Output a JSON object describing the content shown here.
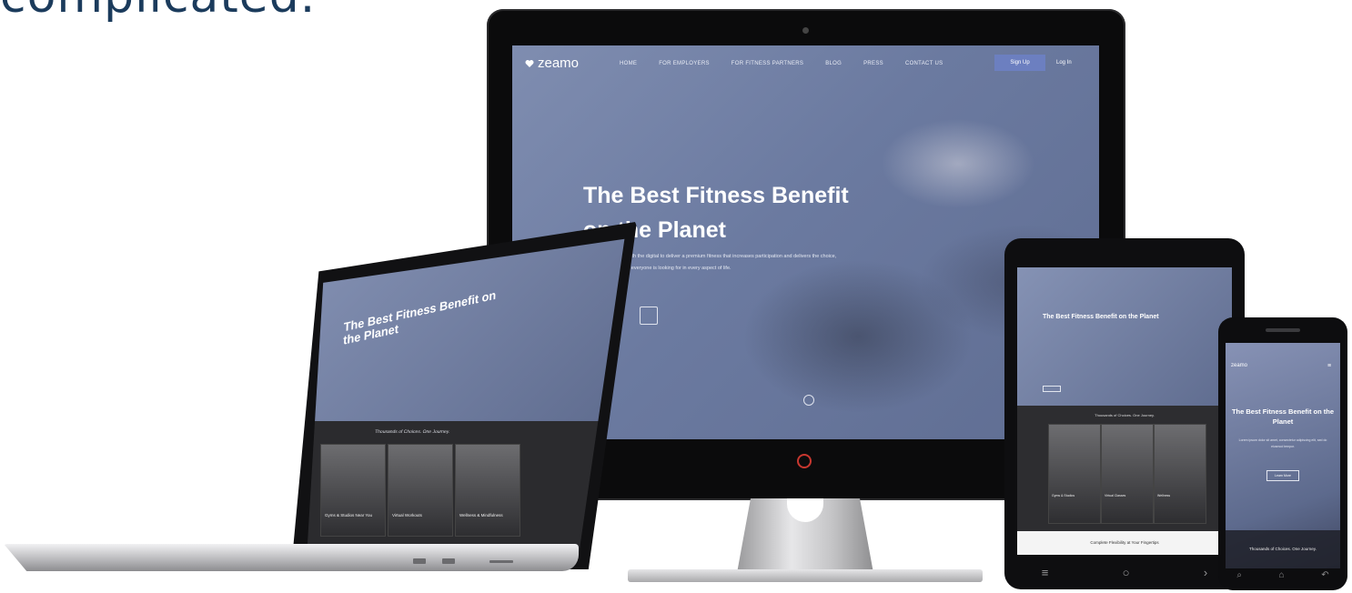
{
  "headline": "complicated.",
  "desktop": {
    "logo": "zeamo",
    "nav_links": [
      "Home",
      "For Employers",
      "For Fitness Partners",
      "Blog",
      "Press",
      "Contact Us"
    ],
    "signup_label": "Sign Up",
    "login_label": "Log In",
    "hero_title_line1": "The Best Fitness Benefit",
    "hero_title_line2": "on the Planet",
    "hero_copy": "blends the physical with the digital to deliver a premium fitness that increases participation and delivers the choice, flexibility, and access everyone is looking for in every aspect of life."
  },
  "laptop": {
    "hero_title": "The Best Fitness Benefit on the Planet",
    "section_title": "Thousands of Choices. One Journey.",
    "cards": [
      "Gyms & Studios Near You",
      "Virtual Workouts",
      "Wellness & Mindfulness"
    ]
  },
  "tablet": {
    "hero_title": "The Best Fitness Benefit on the Planet",
    "section_title": "Thousands of Choices. One Journey.",
    "cards": [
      "Gyms & Studios",
      "Virtual Classes",
      "Wellness"
    ],
    "footer": "Complete Flexibility at Your Fingertips"
  },
  "phone": {
    "logo": "zeamo",
    "hero_title": "The Best Fitness Benefit on the Planet",
    "hero_copy": "Lorem ipsum dolor sit amet, consectetur adipiscing elit, sed do eiusmod tempor.",
    "button": "Learn More",
    "bottom": "Thousands of Choices. One Journey."
  }
}
